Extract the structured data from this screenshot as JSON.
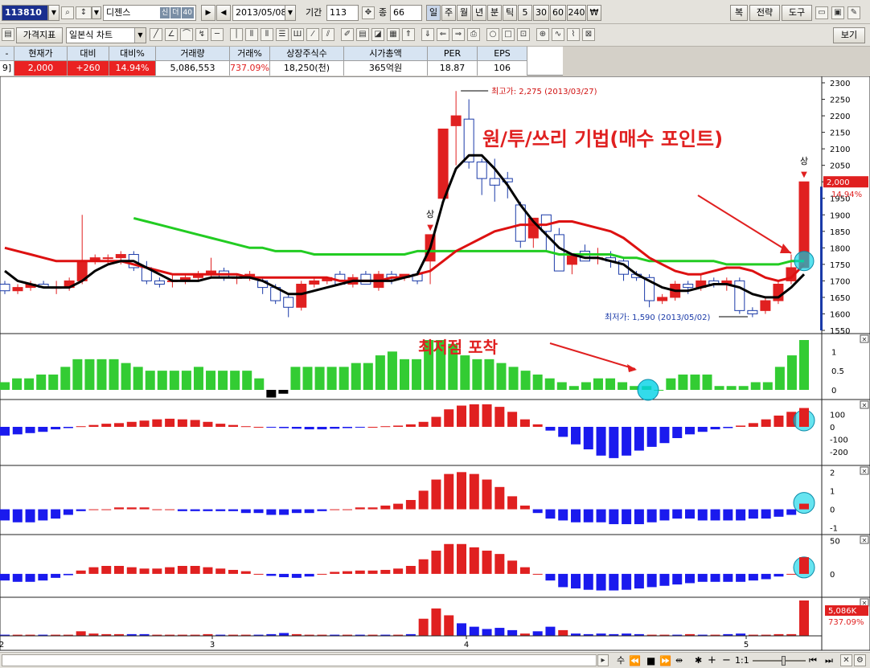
{
  "toolbar1": {
    "code": "113810",
    "stock_name": "디젠스",
    "badges": [
      "신",
      "더",
      "40"
    ],
    "date": "2013/05/08",
    "period_label": "기간",
    "period_value": "113",
    "count_label": "종",
    "count_value": "66",
    "timeframes": [
      "일",
      "주",
      "월",
      "년",
      "분",
      "틱",
      "5",
      "30",
      "60",
      "240",
      "₩"
    ],
    "right_buttons": [
      "복",
      "전략",
      "도구"
    ]
  },
  "toolbar2": {
    "indicator_button": "가격지표",
    "chart_type": "일본식 차트",
    "view_button": "보기"
  },
  "quote": {
    "headers": [
      "현재가",
      "대비",
      "대비%",
      "거래량",
      "거래%",
      "상장주식수",
      "시가총액",
      "PER",
      "EPS"
    ],
    "values": [
      "2,000",
      "+260",
      "14.94%",
      "5,086,553",
      "737.09%",
      "18,250(천)",
      "365억원",
      "18.87",
      "106"
    ],
    "left_stub": "9]"
  },
  "chart_data": {
    "type": "candlestick",
    "price_axis": {
      "min": 1550,
      "max": 2300,
      "step": 50
    },
    "high_annotation": "최고가: 2,275 (2013/03/27)",
    "low_annotation": "최저가: 1,590 (2013/05/02)",
    "current_price_label": "2,000",
    "current_change_label": "14.94%",
    "limit_up_label": "상",
    "x_axis_labels": [
      "2",
      "3",
      "4",
      "5"
    ],
    "candles": [
      [
        1690,
        1700,
        1660,
        1670
      ],
      [
        1670,
        1690,
        1660,
        1680
      ],
      [
        1680,
        1700,
        1670,
        1690
      ],
      [
        1690,
        1700,
        1680,
        1680
      ],
      [
        1680,
        1700,
        1660,
        1680
      ],
      [
        1680,
        1710,
        1670,
        1700
      ],
      [
        1700,
        1900,
        1690,
        1760
      ],
      [
        1760,
        1780,
        1750,
        1770
      ],
      [
        1770,
        1780,
        1750,
        1770
      ],
      [
        1770,
        1790,
        1750,
        1780
      ],
      [
        1780,
        1790,
        1730,
        1740
      ],
      [
        1740,
        1760,
        1690,
        1700
      ],
      [
        1700,
        1710,
        1680,
        1690
      ],
      [
        1700,
        1720,
        1680,
        1700
      ],
      [
        1700,
        1720,
        1690,
        1710
      ],
      [
        1710,
        1730,
        1700,
        1720
      ],
      [
        1720,
        1770,
        1710,
        1730
      ],
      [
        1730,
        1740,
        1700,
        1710
      ],
      [
        1710,
        1720,
        1690,
        1710
      ],
      [
        1710,
        1730,
        1700,
        1720
      ],
      [
        1700,
        1710,
        1660,
        1680
      ],
      [
        1680,
        1690,
        1630,
        1640
      ],
      [
        1650,
        1660,
        1590,
        1620
      ],
      [
        1620,
        1700,
        1610,
        1690
      ],
      [
        1690,
        1710,
        1680,
        1700
      ],
      [
        1700,
        1710,
        1690,
        1710
      ],
      [
        1720,
        1730,
        1690,
        1690
      ],
      [
        1690,
        1720,
        1680,
        1710
      ],
      [
        1720,
        1730,
        1690,
        1690
      ],
      [
        1680,
        1730,
        1670,
        1720
      ],
      [
        1720,
        1730,
        1690,
        1710
      ],
      [
        1710,
        1720,
        1700,
        1720
      ],
      [
        1720,
        1730,
        1690,
        1700
      ],
      [
        1760,
        1840,
        1690,
        1840
      ],
      [
        1950,
        2160,
        1940,
        2160
      ],
      [
        2170,
        2275,
        2050,
        2200
      ],
      [
        2190,
        2250,
        2040,
        2060
      ],
      [
        2060,
        2070,
        1960,
        2010
      ],
      [
        2010,
        2070,
        1940,
        1990
      ],
      [
        2010,
        2030,
        1950,
        2000
      ],
      [
        1930,
        1940,
        1800,
        1820
      ],
      [
        1830,
        1870,
        1800,
        1890
      ],
      [
        1900,
        1880,
        1790,
        1850
      ],
      [
        1840,
        1860,
        1750,
        1730
      ],
      [
        1750,
        1770,
        1720,
        1780
      ],
      [
        1790,
        1810,
        1770,
        1760
      ],
      [
        1770,
        1800,
        1750,
        1770
      ],
      [
        1770,
        1790,
        1740,
        1760
      ],
      [
        1760,
        1770,
        1700,
        1720
      ],
      [
        1720,
        1730,
        1700,
        1710
      ],
      [
        1710,
        1720,
        1620,
        1640
      ],
      [
        1640,
        1660,
        1630,
        1650
      ],
      [
        1650,
        1700,
        1640,
        1690
      ],
      [
        1690,
        1700,
        1660,
        1680
      ],
      [
        1680,
        1720,
        1670,
        1700
      ],
      [
        1700,
        1710,
        1680,
        1690
      ],
      [
        1690,
        1710,
        1670,
        1700
      ],
      [
        1700,
        1710,
        1600,
        1610
      ],
      [
        1610,
        1620,
        1590,
        1600
      ],
      [
        1610,
        1650,
        1600,
        1640
      ],
      [
        1640,
        1700,
        1630,
        1690
      ],
      [
        1700,
        1780,
        1690,
        1740
      ],
      [
        1740,
        2000,
        1740,
        2000
      ]
    ],
    "ma_black": [
      1730,
      1700,
      1690,
      1680,
      1680,
      1680,
      1700,
      1730,
      1750,
      1760,
      1760,
      1740,
      1720,
      1700,
      1700,
      1700,
      1710,
      1710,
      1710,
      1710,
      1700,
      1680,
      1660,
      1660,
      1670,
      1680,
      1690,
      1700,
      1700,
      1700,
      1700,
      1710,
      1720,
      1800,
      1940,
      2040,
      2080,
      2080,
      2040,
      1990,
      1930,
      1880,
      1840,
      1800,
      1780,
      1770,
      1770,
      1760,
      1750,
      1720,
      1700,
      1680,
      1670,
      1670,
      1680,
      1690,
      1690,
      1680,
      1660,
      1650,
      1650,
      1680,
      1720
    ],
    "ma_red": [
      1800,
      1790,
      1780,
      1770,
      1760,
      1760,
      1760,
      1760,
      1760,
      1760,
      1750,
      1740,
      1730,
      1720,
      1720,
      1720,
      1720,
      1720,
      1720,
      1710,
      1710,
      1710,
      1710,
      1710,
      1710,
      1710,
      1700,
      1700,
      1700,
      1700,
      1710,
      1710,
      1720,
      1730,
      1760,
      1790,
      1810,
      1830,
      1850,
      1860,
      1870,
      1870,
      1870,
      1880,
      1880,
      1870,
      1860,
      1850,
      1830,
      1800,
      1770,
      1750,
      1730,
      1720,
      1720,
      1730,
      1740,
      1740,
      1730,
      1710,
      1700,
      1710,
      1750
    ],
    "ma_green": [
      null,
      null,
      null,
      null,
      null,
      null,
      null,
      null,
      null,
      null,
      1890,
      1880,
      1870,
      1860,
      1850,
      1840,
      1830,
      1820,
      1810,
      1800,
      1800,
      1790,
      1790,
      1790,
      1780,
      1780,
      1780,
      1780,
      1780,
      1780,
      1780,
      1780,
      1790,
      1790,
      1790,
      1790,
      1790,
      1790,
      1790,
      1790,
      1790,
      1790,
      1790,
      1780,
      1780,
      1780,
      1780,
      1780,
      1770,
      1770,
      1760,
      1760,
      1760,
      1760,
      1760,
      1760,
      1750,
      1750,
      1750,
      1750,
      1750,
      1760,
      1760
    ],
    "annotations": [
      "원/투/쓰리 기법(매수 포인트)",
      "최저점 포착"
    ],
    "volume_ratio_bars": [
      0.2,
      0.3,
      0.3,
      0.4,
      0.4,
      0.6,
      0.8,
      0.8,
      0.8,
      0.8,
      0.7,
      0.6,
      0.5,
      0.5,
      0.5,
      0.5,
      0.6,
      0.5,
      0.5,
      0.5,
      0.5,
      0.3,
      -0.2,
      -0.1,
      0.6,
      0.6,
      0.6,
      0.6,
      0.6,
      0.7,
      0.7,
      0.9,
      1.0,
      0.8,
      0.8,
      1.3,
      1.3,
      1.2,
      0.9,
      0.8,
      0.8,
      0.7,
      0.6,
      0.5,
      0.4,
      0.3,
      0.2,
      0.1,
      0.2,
      0.3,
      0.3,
      0.2,
      0.1,
      0.1,
      0.0,
      0.3,
      0.4,
      0.4,
      0.4,
      0.1,
      0.1,
      0.1,
      0.2,
      0.2,
      0.6,
      0.9,
      1.3
    ],
    "ind1_labels": [
      "100",
      "0",
      "-100",
      "-200"
    ],
    "ind1": [
      -70,
      -60,
      -50,
      -40,
      -20,
      -10,
      5,
      15,
      25,
      30,
      40,
      50,
      60,
      65,
      60,
      55,
      40,
      25,
      15,
      5,
      0,
      -5,
      -10,
      -15,
      -20,
      -20,
      -15,
      -10,
      -5,
      0,
      5,
      10,
      20,
      40,
      80,
      140,
      170,
      180,
      180,
      160,
      120,
      60,
      20,
      -30,
      -80,
      -140,
      -180,
      -230,
      -250,
      -230,
      -190,
      -160,
      -130,
      -90,
      -60,
      -40,
      -20,
      -10,
      10,
      30,
      60,
      90,
      120,
      150
    ],
    "ind2_labels": [
      "2",
      "1",
      "0",
      "-1"
    ],
    "ind2": [
      -0.6,
      -0.7,
      -0.7,
      -0.6,
      -0.5,
      -0.3,
      -0.1,
      0.0,
      0.0,
      0.1,
      0.1,
      0.1,
      0.0,
      0.0,
      -0.1,
      -0.1,
      -0.1,
      -0.1,
      -0.1,
      -0.2,
      -0.2,
      -0.3,
      -0.3,
      -0.2,
      -0.2,
      -0.1,
      0.0,
      0.0,
      0.1,
      0.1,
      0.2,
      0.3,
      0.5,
      1.0,
      1.6,
      1.9,
      2.0,
      1.9,
      1.6,
      1.2,
      0.7,
      0.2,
      -0.2,
      -0.5,
      -0.6,
      -0.7,
      -0.7,
      -0.7,
      -0.8,
      -0.8,
      -0.8,
      -0.7,
      -0.6,
      -0.5,
      -0.5,
      -0.6,
      -0.6,
      -0.6,
      -0.6,
      -0.5,
      -0.5,
      -0.4,
      -0.3,
      0.3
    ],
    "ind3_labels": [
      "50",
      "0"
    ],
    "ind3": [
      -10,
      -12,
      -12,
      -10,
      -6,
      -2,
      5,
      10,
      12,
      12,
      10,
      8,
      8,
      10,
      12,
      12,
      10,
      8,
      6,
      4,
      0,
      -3,
      -5,
      -6,
      -4,
      0,
      3,
      4,
      5,
      5,
      6,
      8,
      12,
      22,
      35,
      45,
      45,
      40,
      35,
      30,
      20,
      10,
      0,
      -10,
      -20,
      -22,
      -24,
      -25,
      -25,
      -24,
      -22,
      -20,
      -18,
      -16,
      -14,
      -12,
      -12,
      -12,
      -12,
      -10,
      -8,
      -4,
      0,
      25
    ],
    "volume_labels": [
      "5,086K",
      "737.09%"
    ],
    "volume": [
      0.02,
      0.02,
      0.02,
      0.02,
      0.02,
      0.02,
      0.08,
      0.04,
      0.03,
      0.03,
      0.03,
      0.03,
      0.02,
      0.02,
      0.02,
      0.02,
      0.03,
      0.02,
      0.02,
      0.02,
      0.02,
      0.03,
      0.05,
      0.03,
      0.02,
      0.02,
      0.02,
      0.02,
      0.02,
      0.02,
      0.02,
      0.02,
      0.03,
      0.3,
      0.48,
      0.36,
      0.22,
      0.16,
      0.12,
      0.14,
      0.1,
      0.04,
      0.08,
      0.16,
      0.1,
      0.04,
      0.03,
      0.04,
      0.03,
      0.04,
      0.03,
      0.02,
      0.02,
      0.02,
      0.03,
      0.02,
      0.02,
      0.03,
      0.04,
      0.02,
      0.02,
      0.03,
      0.03,
      0.62
    ],
    "volume_colors_up": [
      false,
      true,
      true,
      false,
      true,
      true,
      true,
      true,
      true,
      true,
      false,
      false,
      true,
      true,
      true,
      true,
      true,
      false,
      true,
      true,
      false,
      false,
      false,
      true,
      true,
      true,
      false,
      true,
      false,
      true,
      false,
      true,
      false,
      true,
      true,
      true,
      false,
      false,
      false,
      false,
      false,
      true,
      false,
      false,
      true,
      false,
      false,
      false,
      false,
      false,
      false,
      true,
      true,
      false,
      true,
      false,
      true,
      false,
      false,
      true,
      true,
      true,
      true,
      true
    ]
  },
  "statusbar": {
    "ratio": "1:1",
    "label": "수"
  }
}
